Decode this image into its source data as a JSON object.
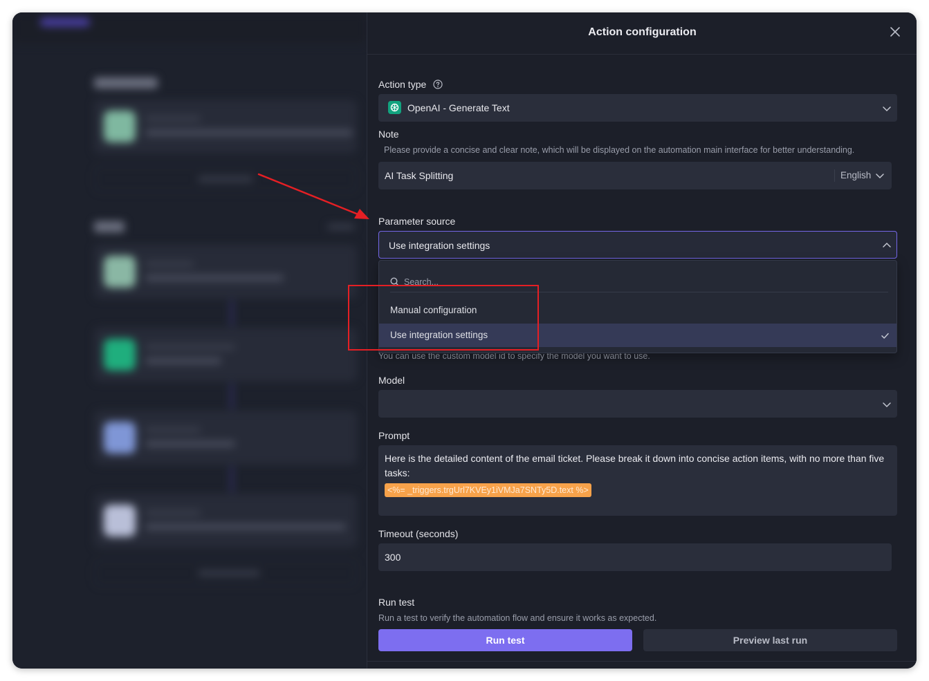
{
  "panel": {
    "title": "Action configuration"
  },
  "action_type": {
    "label": "Action type",
    "value": "OpenAI - Generate Text"
  },
  "note": {
    "label": "Note",
    "hint": "Please provide a concise and clear note, which will be displayed on the automation main interface for better understanding.",
    "value": "AI Task Splitting",
    "language": "English"
  },
  "parameter_source": {
    "label": "Parameter source",
    "value": "Use integration settings",
    "dropdown": {
      "search_placeholder": "Search...",
      "options": [
        {
          "label": "Manual configuration",
          "selected": false
        },
        {
          "label": "Use integration settings",
          "selected": true
        }
      ]
    },
    "hint": "You can use the custom model id to specify the model you want to use."
  },
  "model": {
    "label": "Model",
    "value": ""
  },
  "prompt": {
    "label": "Prompt",
    "text": "Here is the detailed content of the email ticket. Please break it down into concise action items, with no more than five tasks:",
    "variable": "<%= _triggers.trgUrl7KVEy1iVMJa7SNTy5D.text %>"
  },
  "timeout": {
    "label": "Timeout (seconds)",
    "value": "300"
  },
  "run_test": {
    "label": "Run test",
    "hint": "Run a test to verify the automation flow and ensure it works as expected.",
    "run_button": "Run test",
    "preview_button": "Preview last run"
  },
  "colors": {
    "accent": "#7d6ef0",
    "panel_bg": "#1c1f29",
    "field_bg": "#2a2e3b",
    "annotation": "#e51f24",
    "variable_chip": "#f7a24a"
  },
  "icons": [
    "close-icon",
    "help-icon",
    "openai-icon",
    "chevron-down-icon",
    "chevron-up-icon",
    "search-icon",
    "check-icon"
  ]
}
